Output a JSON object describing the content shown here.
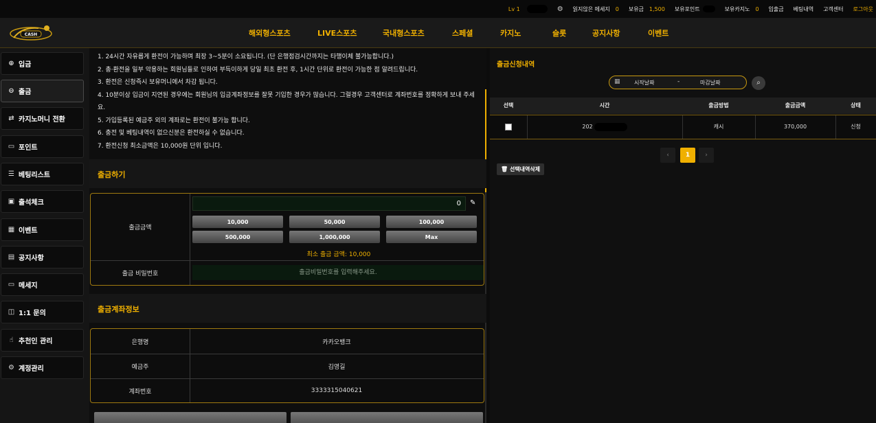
{
  "topbar": {
    "level": "Lv 1",
    "unread_label": "읽지않은 메세지",
    "unread_count": "0",
    "balance_label": "보유금",
    "balance_value": "1,500",
    "points_label": "보유포인트",
    "casino_label": "보유카지노",
    "casino_value": "0",
    "deposit_withdraw": "입출금",
    "betting_history": "베팅내역",
    "customer_center": "고객센터",
    "logout": "로그아웃"
  },
  "logo": {
    "text": "CASH"
  },
  "nav": [
    "해외형스포츠",
    "LIVE스포츠",
    "국내형스포츠",
    "스페셜",
    "카지노",
    "슬롯",
    "공지사항",
    "이벤트"
  ],
  "sidebar": [
    {
      "label": "입금",
      "icon": "circle-plus-icon"
    },
    {
      "label": "출금",
      "icon": "circle-minus-icon",
      "active": true
    },
    {
      "label": "카지노머니 전환",
      "icon": "swap-icon"
    },
    {
      "label": "포인트",
      "icon": "card-icon"
    },
    {
      "label": "베팅리스트",
      "icon": "list-icon"
    },
    {
      "label": "출석체크",
      "icon": "calendar-check-icon"
    },
    {
      "label": "이벤트",
      "icon": "calendar-icon"
    },
    {
      "label": "공지사항",
      "icon": "clipboard-icon"
    },
    {
      "label": "메세지",
      "icon": "chat-icon"
    },
    {
      "label": "1:1 문의",
      "icon": "comments-icon"
    },
    {
      "label": "추천인 관리",
      "icon": "thumbs-up-icon"
    },
    {
      "label": "계정관리",
      "icon": "gear-icon"
    }
  ],
  "notes": [
    "1. 24시간 자유롭게 환전이 가능하며 최장 3~5분이 소요됩니다. (단 은행점검시간까지는 타행이체 불가능합니다.)",
    "2. 총·환전을 일부 악용하는 회원님들로 인하여 부득이하게 당일 최초 환전 후, 1시간 단위로 환전이 가능한 점 알려드립니다.",
    "3. 환전은 신청즉시 보유머니에서 차감 됩니다.",
    "4. 10분이상 입금이 지연된 경우에는 회원님의 입금계좌정보를 잘못 기입한 경우가 많습니다. 그럴경우 고객센터로 계좌번호를 정확하게 보내 주세",
    "요.",
    "5. 가입등록된 예금주 외의 계좌로는 환전이 불가능 합니다.",
    "6. 충전 및 베팅내역이 없으신분은 환전하실 수 없습니다.",
    "7. 환전신청 최소금액은 10,000원 단위 입니다."
  ],
  "withdraw": {
    "title": "출금하기",
    "amount_label": "출금금액",
    "amount_value": "0",
    "buttons": [
      "10,000",
      "50,000",
      "100,000",
      "500,000",
      "1,000,000",
      "Max"
    ],
    "min_text": "최소 출금 금액: 10,000",
    "password_label": "출금 비밀번호",
    "password_placeholder": "출금비밀번호를 입력해주세요."
  },
  "account": {
    "title": "출금계좌정보",
    "bank_label": "은행명",
    "bank_value": "카카오뱅크",
    "holder_label": "예금주",
    "holder_value": "김영길",
    "number_label": "계좌번호",
    "number_value": "3333315040621"
  },
  "history": {
    "title": "출금신청내역",
    "start_placeholder": "시작날짜",
    "dash": "-",
    "end_placeholder": "마감날짜",
    "columns": [
      "선택",
      "시간",
      "출금방법",
      "출금금액",
      "상태"
    ],
    "rows": [
      {
        "time": "202",
        "method": "캐시",
        "amount": "370,000",
        "status": "신청"
      }
    ],
    "page_prev": "‹",
    "page_current": "1",
    "page_next": "›",
    "delete_label": "선택내역삭제"
  },
  "colors": {
    "accent": "#f0b000",
    "background": "#0c0c0c",
    "border_gold": "#a07a10"
  }
}
